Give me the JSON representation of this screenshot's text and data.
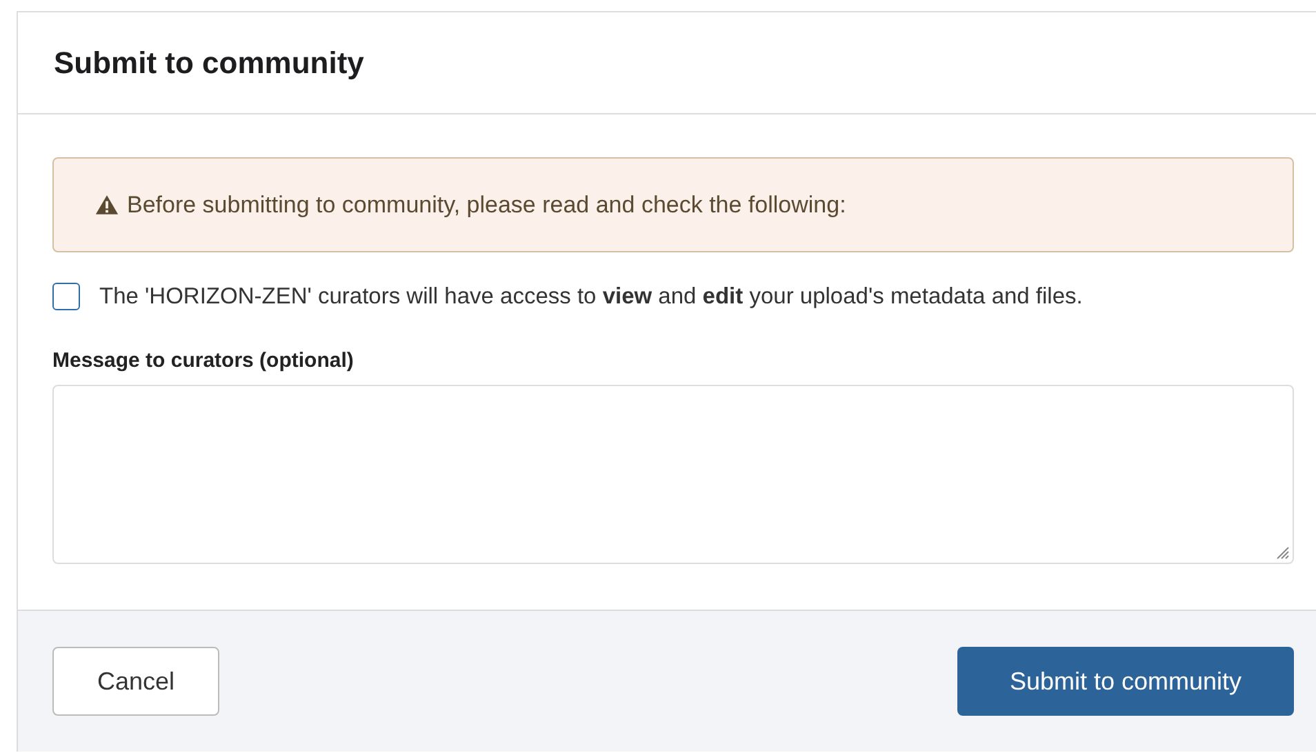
{
  "dialog": {
    "title": "Submit to community"
  },
  "warning": {
    "text": "Before submitting to community, please read and check the following:"
  },
  "agreement": {
    "checked": false,
    "text": "The 'HORIZON-ZEN' curators will have access to **view** and **edit** your upload's metadata and files."
  },
  "message": {
    "label": "Message to curators (optional)"
  },
  "buttons": [
    {
      "kind": "secondary",
      "label": "Cancel"
    },
    {
      "kind": "primary",
      "label": "Submit to community"
    }
  ]
}
